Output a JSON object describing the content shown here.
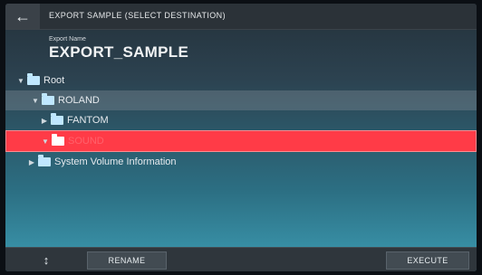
{
  "window": {
    "title": "EXPORT SAMPLE (SELECT DESTINATION)"
  },
  "export": {
    "label": "Export Name",
    "value": "EXPORT_SAMPLE"
  },
  "tree": {
    "items": [
      {
        "label": "Root"
      },
      {
        "label": "ROLAND"
      },
      {
        "label": "FANTOM"
      },
      {
        "label": "SOUND"
      },
      {
        "label": "System Volume Information"
      }
    ]
  },
  "toolbar": {
    "updown_icon": "updown-arrows",
    "rename_label": "RENAME",
    "execute_label": "EXECUTE"
  },
  "colors": {
    "selection": "#ff3b47",
    "folder": "#bfe7ff"
  }
}
